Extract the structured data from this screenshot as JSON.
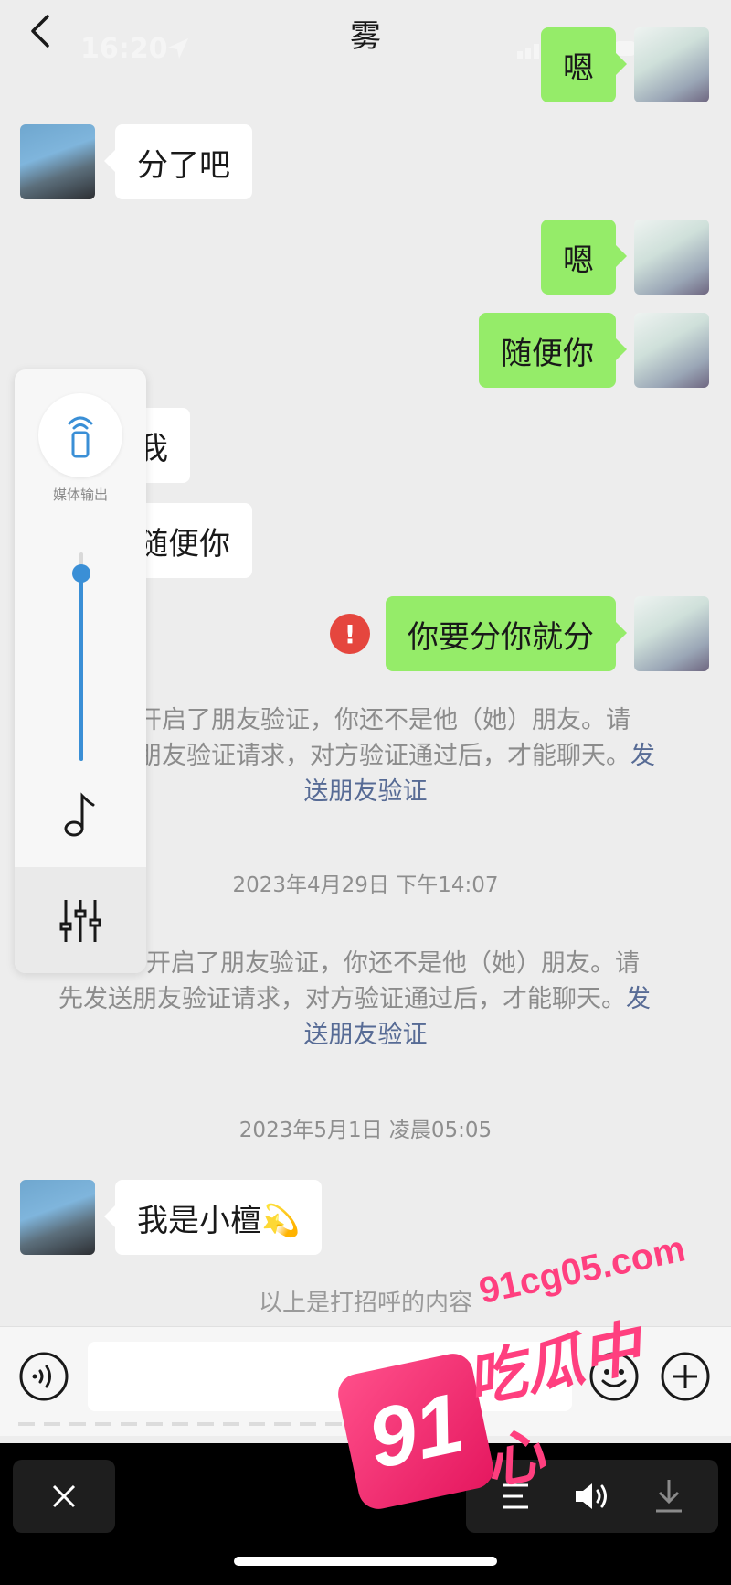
{
  "header": {
    "title": "雾",
    "status_time": "16:20"
  },
  "messages": [
    {
      "side": "right",
      "text": "嗯"
    },
    {
      "side": "left",
      "text": "分了吧"
    },
    {
      "side": "right",
      "text": "嗯"
    },
    {
      "side": "right",
      "text": "随便你"
    },
    {
      "side": "left",
      "text": "我"
    },
    {
      "side": "left",
      "text": "随便你"
    },
    {
      "side": "right",
      "text": "你要分你就分",
      "status": "failed"
    }
  ],
  "system_notices": [
    {
      "text": "开启了朋友验证，你还不是他（她）朋友。请先发送朋友验证请求，对方验证通过后，才能聊天。",
      "link": "发送朋友验证"
    },
    {
      "text": "开启了朋友验证，你还不是他（她）朋友。请先发送朋友验证请求，对方验证通过后，才能聊天。",
      "link": "发送朋友验证"
    }
  ],
  "notice_1": {
    "line1": "开启了朋友验证，你还不是他（她）朋友。请",
    "line2": "朋友验证请求，对方验证通过后，才能聊天。",
    "link_part1": "发",
    "link_part2": "送朋友验证"
  },
  "notice_2": {
    "line1": "开启了朋友验证，你还不是他（她）朋友。请",
    "line2": "先发送朋友验证请求，对方验证通过后，才能聊天。",
    "link_part1": "发",
    "link_part2": "送朋友验证"
  },
  "timestamps": [
    "2023年4月29日 下午14:07",
    "2023年5月1日 凌晨05:05"
  ],
  "last_message": {
    "side": "left",
    "text": "我是小檀💫"
  },
  "greeting_note": "以上是打招呼的内容",
  "media_panel": {
    "output_label": "媒体输出",
    "volume_level": 0.9
  },
  "icons": {
    "back": "chevron-left-icon",
    "more": "more-dots-icon",
    "voice": "voice-input-icon",
    "emoji": "emoji-icon",
    "add": "plus-circle-icon",
    "close": "close-icon",
    "playlist": "playlist-icon",
    "speaker": "speaker-icon",
    "download": "download-icon"
  },
  "colors": {
    "sent_bubble": "#95ec69",
    "received_bubble": "#ffffff",
    "link": "#576b95",
    "error": "#e5463e",
    "slider": "#3a8fd6",
    "watermark": "#ff3f7f"
  },
  "watermark": {
    "badge": "91",
    "url": "91cg05.com",
    "name": "吃瓜中心"
  }
}
